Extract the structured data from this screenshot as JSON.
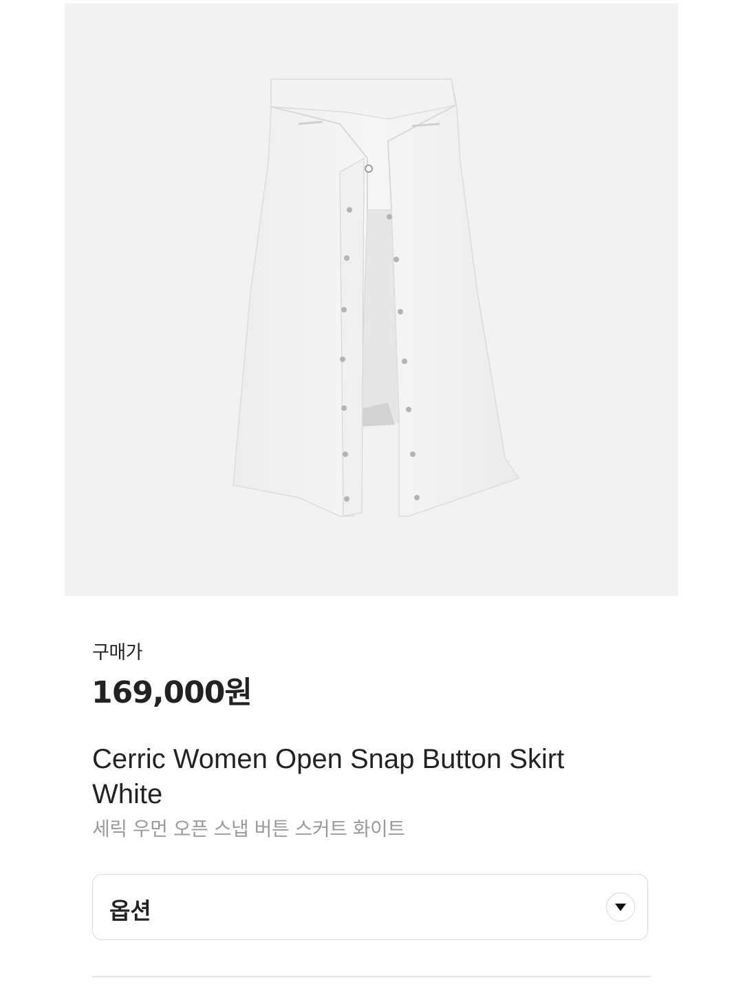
{
  "product": {
    "image_alt": "Cerric Women Open Snap Button Skirt White",
    "price_label": "구매가",
    "price": "169,000원",
    "name_en": "Cerric Women Open Snap Button Skirt White",
    "name_ko": "세릭 우먼 오픈 스냅 버튼 스커트 화이트"
  },
  "options": {
    "label": "옵션",
    "icon": "chevron-down-icon"
  },
  "colors": {
    "image_background": "#f2f2f2",
    "text_primary": "#222222",
    "text_secondary": "#9a9a9a",
    "border": "#d6d6d6"
  }
}
